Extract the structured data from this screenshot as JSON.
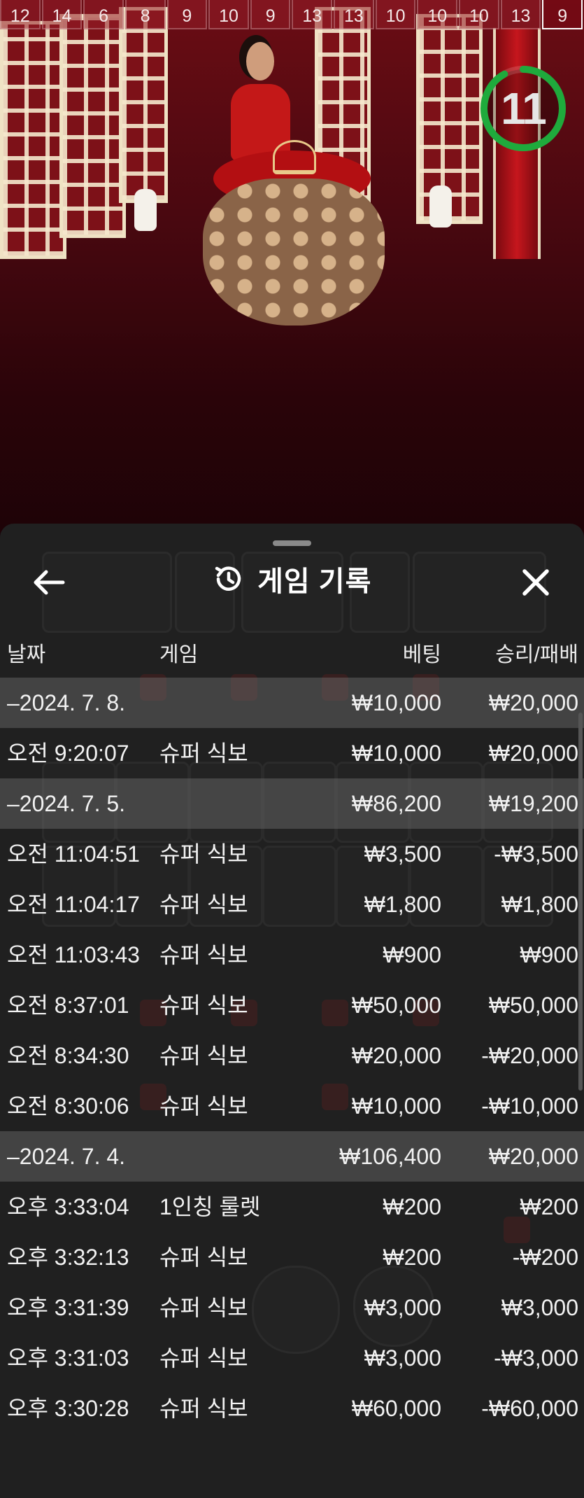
{
  "history_strip": [
    "12",
    "14",
    "6",
    "8",
    "9",
    "10",
    "9",
    "13",
    "13",
    "10",
    "10",
    "10",
    "13",
    "9"
  ],
  "timer": {
    "value": "11",
    "progress_fraction": 0.92,
    "color": "#1faa3c"
  },
  "sheet": {
    "title": "게임 기록",
    "columns": {
      "date": "날짜",
      "game": "게임",
      "bet": "베팅",
      "win_loss": "승리/패배"
    },
    "rows": [
      {
        "kind": "date",
        "time": "–2024. 7. 8.",
        "game": "",
        "bet": "₩10,000",
        "result": "₩20,000"
      },
      {
        "kind": "entry",
        "time": "오전 9:20:07",
        "game": "슈퍼 식보",
        "bet": "₩10,000",
        "result": "₩20,000"
      },
      {
        "kind": "date",
        "time": "–2024. 7. 5.",
        "game": "",
        "bet": "₩86,200",
        "result": "₩19,200"
      },
      {
        "kind": "entry",
        "time": "오전 11:04:51",
        "game": "슈퍼 식보",
        "bet": "₩3,500",
        "result": "-₩3,500"
      },
      {
        "kind": "entry",
        "time": "오전 11:04:17",
        "game": "슈퍼 식보",
        "bet": "₩1,800",
        "result": "₩1,800"
      },
      {
        "kind": "entry",
        "time": "오전 11:03:43",
        "game": "슈퍼 식보",
        "bet": "₩900",
        "result": "₩900"
      },
      {
        "kind": "entry",
        "time": "오전 8:37:01",
        "game": "슈퍼 식보",
        "bet": "₩50,000",
        "result": "₩50,000"
      },
      {
        "kind": "entry",
        "time": "오전 8:34:30",
        "game": "슈퍼 식보",
        "bet": "₩20,000",
        "result": "-₩20,000"
      },
      {
        "kind": "entry",
        "time": "오전 8:30:06",
        "game": "슈퍼 식보",
        "bet": "₩10,000",
        "result": "-₩10,000"
      },
      {
        "kind": "date",
        "time": "–2024. 7. 4.",
        "game": "",
        "bet": "₩106,400",
        "result": "₩20,000"
      },
      {
        "kind": "entry",
        "time": "오후 3:33:04",
        "game": "1인칭 룰렛",
        "bet": "₩200",
        "result": "₩200"
      },
      {
        "kind": "entry",
        "time": "오후 3:32:13",
        "game": "슈퍼 식보",
        "bet": "₩200",
        "result": "-₩200"
      },
      {
        "kind": "entry",
        "time": "오후 3:31:39",
        "game": "슈퍼 식보",
        "bet": "₩3,000",
        "result": "₩3,000"
      },
      {
        "kind": "entry",
        "time": "오후 3:31:03",
        "game": "슈퍼 식보",
        "bet": "₩3,000",
        "result": "-₩3,000"
      },
      {
        "kind": "entry",
        "time": "오후 3:30:28",
        "game": "슈퍼 식보",
        "bet": "₩60,000",
        "result": "-₩60,000"
      }
    ]
  },
  "colors": {
    "sheet_bg": "#202020",
    "date_row_bg": "#555555",
    "accent_green": "#1faa3c"
  },
  "icons": {
    "back": "arrow-left-icon",
    "history": "history-clock-icon",
    "close": "close-x-icon"
  }
}
